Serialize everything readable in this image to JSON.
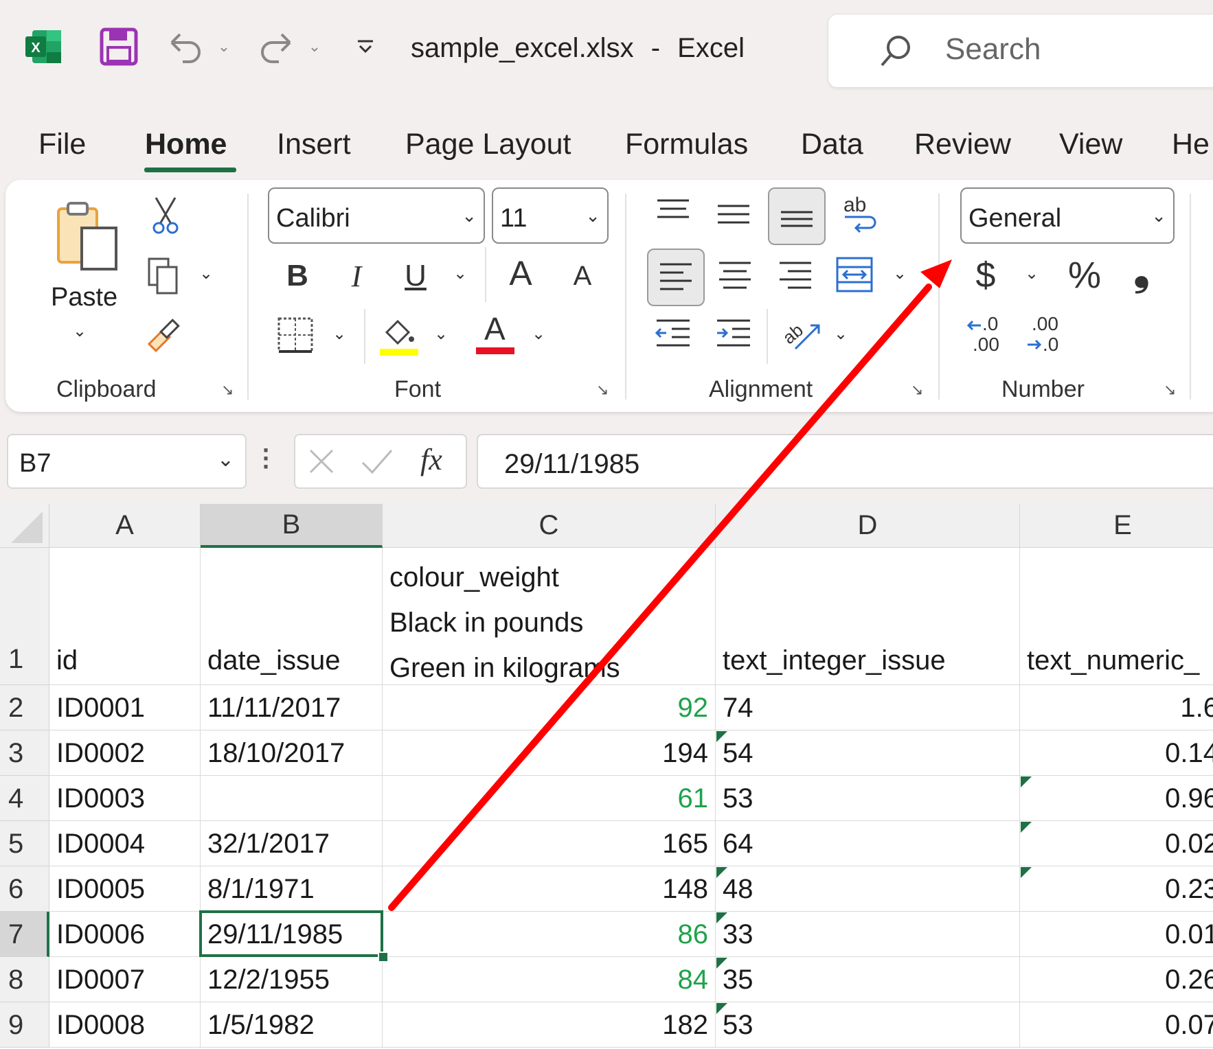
{
  "window": {
    "file_name": "sample_excel.xlsx",
    "separator": "-",
    "app_name": "Excel",
    "search_placeholder": "Search"
  },
  "quick_access": {
    "icons": [
      "excel-logo-icon",
      "save-icon",
      "undo-icon",
      "redo-icon",
      "customize-quick-access-icon"
    ]
  },
  "tabs": [
    "File",
    "Home",
    "Insert",
    "Page Layout",
    "Formulas",
    "Data",
    "Review",
    "View",
    "He"
  ],
  "active_tab": "Home",
  "ribbon": {
    "clipboard": {
      "label": "Clipboard",
      "paste_label": "Paste"
    },
    "font": {
      "label": "Font",
      "font_name": "Calibri",
      "font_size": "11",
      "bold": "B",
      "italic": "I",
      "underline": "U",
      "grow": "A",
      "shrink": "A",
      "font_color_glyph": "A",
      "highlight_color": "#ffff00",
      "font_color": "#e81123"
    },
    "alignment": {
      "label": "Alignment",
      "wrap_glyph": "ab"
    },
    "number": {
      "label": "Number",
      "format": "General",
      "currency": "$",
      "percent": "%",
      "comma": "❟",
      "inc_decimal_top": ".0",
      "inc_decimal_bottom": ".00",
      "dec_decimal_top": ".00",
      "dec_decimal_bottom": ".0"
    }
  },
  "formula_bar": {
    "name_box": "B7",
    "fx": "fx",
    "value": "29/11/1985"
  },
  "sheet": {
    "selected_cell": "B7",
    "columns": [
      "A",
      "B",
      "C",
      "D",
      "E"
    ],
    "rows": [
      "1",
      "2",
      "3",
      "4",
      "5",
      "6",
      "7",
      "8",
      "9"
    ],
    "header": {
      "a": "id",
      "b": "date_issue",
      "c1": "colour_weight",
      "c2": "Black in pounds",
      "c3": "Green in kilograms",
      "d": "text_integer_issue",
      "e": "text_numeric_"
    },
    "data": [
      {
        "id": "ID0001",
        "date": "11/11/2017",
        "weight": "92",
        "weight_color": "green",
        "text_int": "74",
        "text_num": "1.6"
      },
      {
        "id": "ID0002",
        "date": "18/10/2017",
        "weight": "194",
        "weight_color": "black",
        "text_int": "54",
        "text_num": "0.14"
      },
      {
        "id": "ID0003",
        "date": "",
        "weight": "61",
        "weight_color": "green",
        "text_int": "53",
        "text_num": "0.96"
      },
      {
        "id": "ID0004",
        "date": "32/1/2017",
        "weight": "165",
        "weight_color": "black",
        "text_int": "64",
        "text_num": "0.02"
      },
      {
        "id": "ID0005",
        "date": "8/1/1971",
        "weight": "148",
        "weight_color": "black",
        "text_int": "48",
        "text_num": "0.23"
      },
      {
        "id": "ID0006",
        "date": "29/11/1985",
        "weight": "86",
        "weight_color": "green",
        "text_int": "33",
        "text_num": "0.01"
      },
      {
        "id": "ID0007",
        "date": "12/2/1955",
        "weight": "84",
        "weight_color": "green",
        "text_int": "35",
        "text_num": "0.26"
      },
      {
        "id": "ID0008",
        "date": "1/5/1982",
        "weight": "182",
        "weight_color": "black",
        "text_int": "53",
        "text_num": "0.07"
      }
    ]
  },
  "annotation": {
    "arrow_color": "#ff0000"
  }
}
